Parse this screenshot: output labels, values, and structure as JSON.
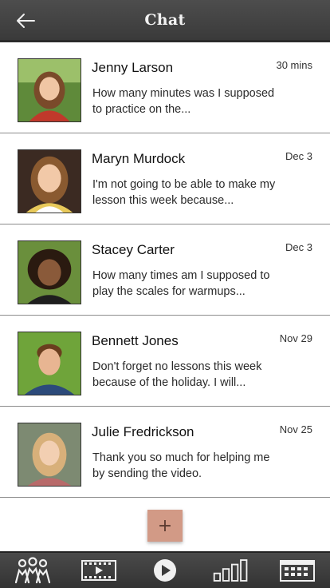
{
  "header": {
    "title": "Chat",
    "back_icon": "arrow-left-icon"
  },
  "conversations": [
    {
      "name": "Jenny Larson",
      "time": "30 mins",
      "preview": "How many minutes was I supposed to practice on the...",
      "avatar_bg": "#5f8a3a"
    },
    {
      "name": "Maryn Murdock",
      "time": "Dec 3",
      "preview": "I'm not going to be able to make my lesson this week because...",
      "avatar_bg": "#3b2a22"
    },
    {
      "name": "Stacey Carter",
      "time": "Dec 3",
      "preview": "How many times am I supposed to play the scales for warmups...",
      "avatar_bg": "#6a8f3c"
    },
    {
      "name": "Bennett Jones",
      "time": "Nov 29",
      "preview": "Don't forget no lessons this week because of the holiday. I will...",
      "avatar_bg": "#6fa43a"
    },
    {
      "name": "Julie Fredrickson",
      "time": "Nov 25",
      "preview": "Thank you so much for helping me by sending the video.",
      "avatar_bg": "#7d8a72"
    }
  ],
  "add_button": {
    "label": "+",
    "color": "#d29a86"
  },
  "tabbar": {
    "icons": [
      "students-icon",
      "video-icon",
      "play-icon",
      "stats-icon",
      "calendar-icon"
    ]
  },
  "colors": {
    "header_bg": "#444444",
    "tabbar_bg": "#3a3a3a",
    "divider": "#8c8c8c"
  }
}
